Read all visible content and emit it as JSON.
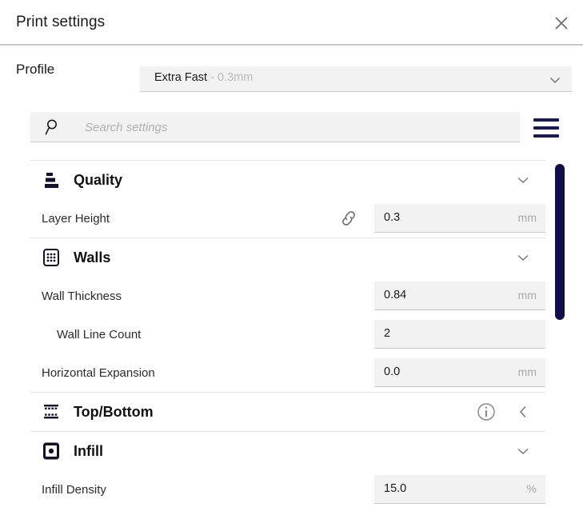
{
  "window": {
    "title": "Print settings",
    "close_icon": "close-icon"
  },
  "profile": {
    "label": "Profile",
    "value_name": "Extra Fast",
    "value_detail": " - 0.3mm",
    "chevron_icon": "chevron-down-icon"
  },
  "search": {
    "placeholder": "Search settings",
    "value": "",
    "icon": "search-icon",
    "menu_icon": "hamburger-menu-icon"
  },
  "sections": [
    {
      "id": "quality",
      "title": "Quality",
      "icon": "layer-height-icon",
      "state_icon": "chevron-down-icon",
      "has_info": false,
      "rows": [
        {
          "label": "Layer Height",
          "indent": false,
          "value": "0.3",
          "unit": "mm",
          "linked": true,
          "link_icon": "chain-link-icon"
        }
      ]
    },
    {
      "id": "walls",
      "title": "Walls",
      "icon": "walls-grid-icon",
      "state_icon": "chevron-down-icon",
      "has_info": false,
      "rows": [
        {
          "label": "Wall Thickness",
          "indent": false,
          "value": "0.84",
          "unit": "mm",
          "linked": false,
          "link_icon": ""
        },
        {
          "label": "Wall Line Count",
          "indent": true,
          "value": "2",
          "unit": "",
          "linked": false,
          "link_icon": ""
        },
        {
          "label": "Horizontal Expansion",
          "indent": false,
          "value": "0.0",
          "unit": "mm",
          "linked": false,
          "link_icon": ""
        }
      ]
    },
    {
      "id": "top-bottom",
      "title": "Top/Bottom",
      "icon": "top-bottom-layers-icon",
      "state_icon": "chevron-left-icon",
      "has_info": true,
      "info_icon": "info-icon",
      "rows": []
    },
    {
      "id": "infill",
      "title": "Infill",
      "icon": "infill-pattern-icon",
      "state_icon": "chevron-down-icon",
      "has_info": false,
      "rows": [
        {
          "label": "Infill Density",
          "indent": false,
          "value": "15.0",
          "unit": "%",
          "linked": false,
          "link_icon": ""
        }
      ]
    }
  ],
  "scrollbar": {
    "name": "settings-scrollbar",
    "color": "#100f4a"
  },
  "colors": {
    "accent": "#100f4a",
    "field_bg": "#f2f2f2",
    "text": "#1a1a1a",
    "muted": "#a8a8a8"
  }
}
